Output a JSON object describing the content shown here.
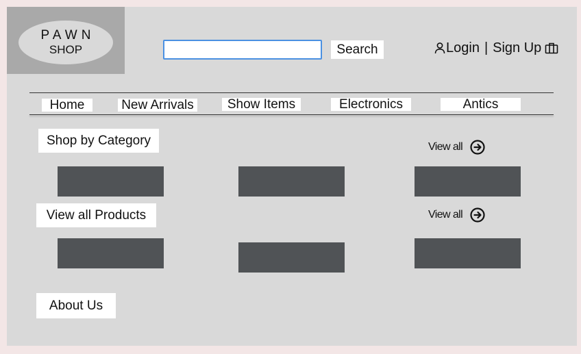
{
  "logo": {
    "line1": "PAWN",
    "line2": "SHOP"
  },
  "search": {
    "placeholder": "",
    "value": "",
    "button_label": "Search"
  },
  "auth": {
    "login_label": "Login",
    "separator": "|",
    "signup_label": "Sign Up"
  },
  "nav": {
    "items": [
      {
        "label": "Home"
      },
      {
        "label": "New Arrivals"
      },
      {
        "label": "Show Items"
      },
      {
        "label": "Electronics"
      },
      {
        "label": "Antics"
      }
    ]
  },
  "sections": {
    "category": {
      "title": "Shop by Category",
      "view_all_label": "View all"
    },
    "products": {
      "title": "View all Products",
      "view_all_label": "View all"
    },
    "about": {
      "title": "About Us"
    }
  },
  "colors": {
    "page_background": "#f3e6e6",
    "frame": "#d9d9d9",
    "logo_box": "#a9a9a9",
    "tile": "#505356",
    "search_border": "#4a90e2"
  },
  "icons": {
    "user": "user-icon",
    "bag": "bag-icon",
    "arrow": "arrow-circle-right-icon"
  }
}
